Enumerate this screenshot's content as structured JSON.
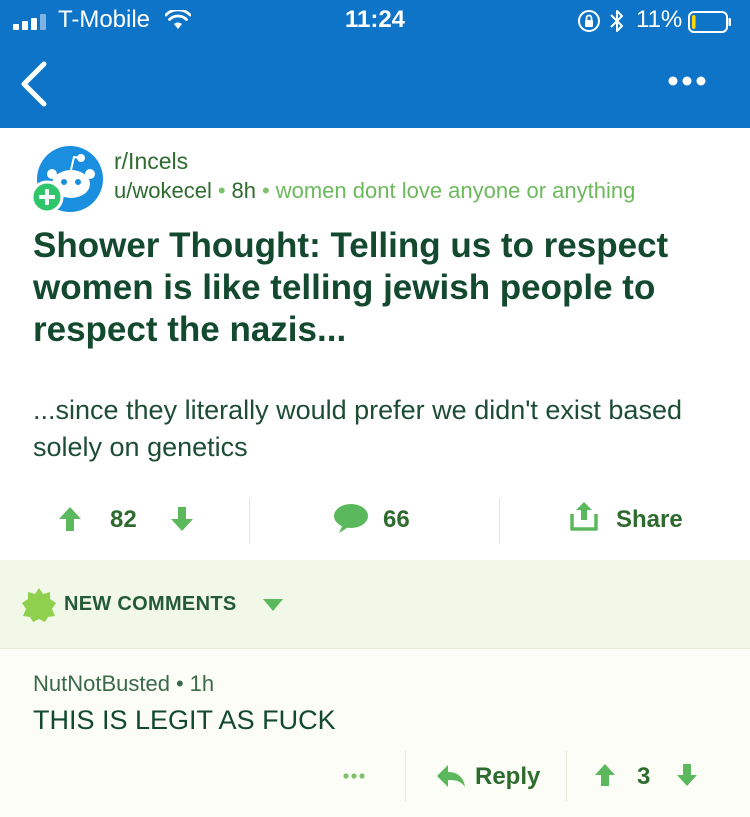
{
  "status_bar": {
    "carrier": "T-Mobile",
    "time": "11:24",
    "battery_percent": "11%",
    "battery_level": 0.11
  },
  "app_bar": {
    "back_icon": "chevron-left-icon",
    "more_icon": "more-dots-icon"
  },
  "post": {
    "subreddit": "r/Incels",
    "author": "u/wokecel",
    "age": "8h",
    "flair": "women dont love anyone or anything",
    "title": "Shower Thought: Telling us to respect women is like telling jewish people to respect the nazis...",
    "body": "...since they literally would prefer we didn't exist based solely on genetics",
    "score": "82",
    "comment_count": "66",
    "share_label": "Share"
  },
  "comments": {
    "sort_label": "NEW COMMENTS",
    "items": [
      {
        "author": "NutNotBusted",
        "age": "1h",
        "body": "THIS IS LEGIT AS FUCK",
        "reply_label": "Reply",
        "score": "3"
      }
    ]
  },
  "colors": {
    "app_bar": "#0d74c8",
    "accent_green": "#2e6b2e",
    "icon_green": "#5cb85c",
    "title_green": "#12492f",
    "comments_bg": "#f1f8e8"
  }
}
